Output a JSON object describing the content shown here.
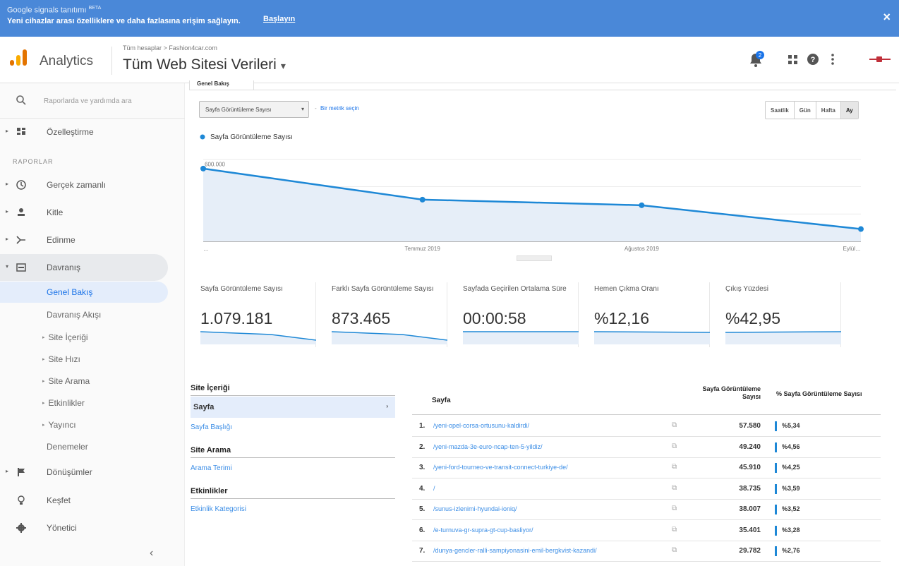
{
  "banner": {
    "line1": "Google signals tanıtımı",
    "beta": "BETA",
    "line2": "Yeni cihazlar arası özelliklere ve daha fazlasına erişim sağlayın.",
    "cta": "Başlayın",
    "close_icon": "×"
  },
  "header": {
    "app_name": "Analytics",
    "breadcrumb": "Tüm hesaplar > Fashion4car.com",
    "view_name": "Tüm Web Sitesi Verileri",
    "view_caret": "▾",
    "notifications_count": "2",
    "icons": [
      "notifications-icon",
      "apps-grid-icon",
      "help-icon",
      "more-vert-icon",
      "account-avatar-icon"
    ]
  },
  "sidebar": {
    "search_placeholder": "Raporlarda ve yardımda ara",
    "customization": "Özelleştirme",
    "reports_heading": "RAPORLAR",
    "realtime": "Gerçek zamanlı",
    "audience": "Kitle",
    "acquisition": "Edinme",
    "behavior": "Davranış",
    "behavior_sub": {
      "overview": "Genel Bakış",
      "flow": "Davranış Akışı",
      "site_content": "Site İçeriği",
      "site_speed": "Site Hızı",
      "site_search": "Site Arama",
      "events": "Etkinlikler",
      "publisher": "Yayıncı",
      "experiments": "Denemeler"
    },
    "conversions": "Dönüşümler",
    "discover": "Keşfet",
    "admin": "Yönetici",
    "collapse": "‹"
  },
  "main": {
    "tab": "Genel Bakış",
    "metric_dropdown": "Sayfa Görüntüleme Sayısı",
    "vs": "-",
    "add_metric": "Bir metrik seçin",
    "granularity": [
      "Saatlik",
      "Gün",
      "Hafta",
      "Ay"
    ],
    "selected_granularity": "Ay"
  },
  "chart_data": {
    "type": "line",
    "legend": "Sayfa Görüntüleme Sayısı",
    "x": [
      "…",
      "Temmuz 2019",
      "Ağustos 2019",
      "Eylül…"
    ],
    "values": [
      532000,
      305000,
      264000,
      90000
    ],
    "ytick_labels": [
      "600.000",
      "400.000",
      "200.000"
    ],
    "yticks": [
      600000,
      400000,
      200000
    ],
    "ylim": [
      0,
      650000
    ],
    "color": "#1e88d6",
    "grid": true
  },
  "scorecards": [
    {
      "name": "Sayfa Görüntüleme Sayısı",
      "value": "1.079.181"
    },
    {
      "name": "Farklı Sayfa Görüntüleme Sayısı",
      "value": "873.465"
    },
    {
      "name": "Sayfada Geçirilen Ortalama Süre",
      "value": "00:00:58"
    },
    {
      "name": "Hemen Çıkma Oranı",
      "value": "%12,16"
    },
    {
      "name": "Çıkış Yüzdesi",
      "value": "%42,95"
    }
  ],
  "dimensions": {
    "site_content_heading": "Site İçeriği",
    "page": "Sayfa",
    "page_arrow": "›",
    "page_title": "Sayfa Başlığı",
    "site_search_heading": "Site Arama",
    "search_term": "Arama Terimi",
    "events_heading": "Etkinlikler",
    "event_category": "Etkinlik Kategorisi"
  },
  "table": {
    "col_page": "Sayfa",
    "col_views": "Sayfa Görüntüleme Sayısı",
    "col_pct": "% Sayfa Görüntüleme Sayısı",
    "rows": [
      {
        "n": "1.",
        "url": "/yeni-opel-corsa-ortusunu-kaldirdi/",
        "views": "57.580",
        "pct": "%5,34"
      },
      {
        "n": "2.",
        "url": "/yeni-mazda-3e-euro-ncap-ten-5-yildiz/",
        "views": "49.240",
        "pct": "%4,56"
      },
      {
        "n": "3.",
        "url": "/yeni-ford-tourneo-ve-transit-connect-turkiye-de/",
        "views": "45.910",
        "pct": "%4,25"
      },
      {
        "n": "4.",
        "url": "/",
        "views": "38.735",
        "pct": "%3,59"
      },
      {
        "n": "5.",
        "url": "/sunus-izlenimi-hyundai-ioniq/",
        "views": "38.007",
        "pct": "%3,52"
      },
      {
        "n": "6.",
        "url": "/e-turnuva-gr-supra-gt-cup-basliyor/",
        "views": "35.401",
        "pct": "%3,28"
      },
      {
        "n": "7.",
        "url": "/dunya-gencler-ralli-sampiyonasini-emil-bergkvist-kazandi/",
        "views": "29.782",
        "pct": "%2,76"
      }
    ]
  }
}
